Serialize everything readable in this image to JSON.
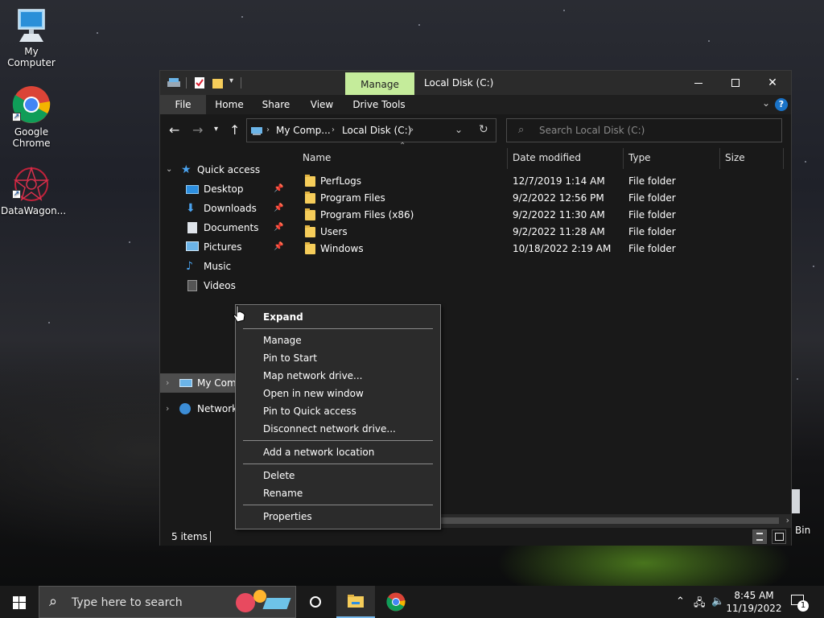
{
  "desktop": {
    "icons": [
      {
        "label": "My Computer"
      },
      {
        "label": "Google Chrome"
      },
      {
        "label": "DataWagon..."
      }
    ],
    "recycle_bin_partial": "Bin"
  },
  "window": {
    "title": "Local Disk (C:)",
    "manage_tab": "Manage",
    "ribbon_tabs": [
      "File",
      "Home",
      "Share",
      "View",
      "Drive Tools"
    ],
    "help": "?",
    "address": {
      "parts": [
        "My Comp...",
        "Local Disk (C:)"
      ]
    },
    "search_placeholder": "Search Local Disk (C:)",
    "nav": {
      "quick_access": "Quick access",
      "items": [
        "Desktop",
        "Downloads",
        "Documents",
        "Pictures",
        "Music",
        "Videos"
      ],
      "my_computer": "My Com",
      "network": "Network"
    },
    "columns": [
      "Name",
      "Date modified",
      "Type",
      "Size"
    ],
    "rows": [
      {
        "name": "PerfLogs",
        "date": "12/7/2019 1:14 AM",
        "type": "File folder"
      },
      {
        "name": "Program Files",
        "date": "9/2/2022 12:56 PM",
        "type": "File folder"
      },
      {
        "name": "Program Files (x86)",
        "date": "9/2/2022 11:30 AM",
        "type": "File folder"
      },
      {
        "name": "Users",
        "date": "9/2/2022 11:28 AM",
        "type": "File folder"
      },
      {
        "name": "Windows",
        "date": "10/18/2022 2:19 AM",
        "type": "File folder"
      }
    ],
    "status": "5 items"
  },
  "context_menu": {
    "items": [
      "Expand",
      "Manage",
      "Pin to Start",
      "Map network drive...",
      "Open in new window",
      "Pin to Quick access",
      "Disconnect network drive...",
      "Add a network location",
      "Delete",
      "Rename",
      "Properties"
    ]
  },
  "taskbar": {
    "search_placeholder": "Type here to search",
    "time": "8:45 AM",
    "date": "11/19/2022",
    "notification_count": "1"
  },
  "colors": {
    "manage_tab": "#c5ec9b",
    "accent": "#1a73c7",
    "folder": "#f6cd5a"
  }
}
